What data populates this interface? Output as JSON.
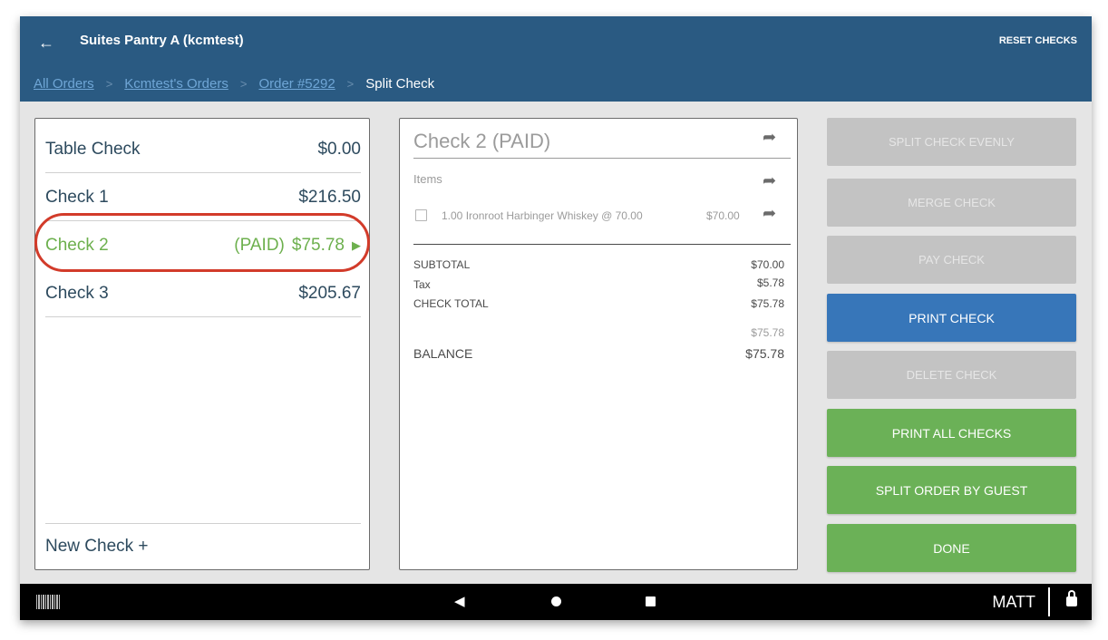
{
  "header": {
    "back_icon": "arrow-left-icon",
    "title": "Suites Pantry A (kcmtest)",
    "reset_label": "RESET CHECKS"
  },
  "breadcrumb": {
    "items": [
      "All Orders",
      "Kcmtest's Orders",
      "Order #5292"
    ],
    "separator": ">",
    "current": "Split Check"
  },
  "checks": {
    "list": [
      {
        "name": "Table Check",
        "status": "",
        "amount": "$0.00"
      },
      {
        "name": "Check 1",
        "status": "",
        "amount": "$216.50"
      },
      {
        "name": "Check 2",
        "status": "(PAID)",
        "amount": "$75.78",
        "selected": true
      },
      {
        "name": "Check 3",
        "status": "",
        "amount": "$205.67"
      }
    ],
    "selected_arrow": "▶",
    "new_check_label": "New Check +"
  },
  "detail": {
    "title": "Check 2 (PAID)",
    "items_label": "Items",
    "items": [
      {
        "description": "1.00 Ironroot Harbinger Whiskey @  70.00",
        "price": "$70.00"
      }
    ],
    "subtotal_label": "SUBTOTAL",
    "subtotal": "$70.00",
    "tax_label": "Tax",
    "tax": "$5.78",
    "total_label": "CHECK TOTAL",
    "total": "$75.78",
    "paid_amount": "$75.78",
    "balance_label": "BALANCE",
    "balance": "$75.78"
  },
  "actions": {
    "split_evenly": "SPLIT CHECK EVENLY",
    "merge": "MERGE CHECK",
    "pay": "PAY CHECK",
    "print": "PRINT CHECK",
    "delete": "DELETE CHECK",
    "print_all": "PRINT ALL CHECKS",
    "split_by_guest": "SPLIT ORDER BY GUEST",
    "done": "DONE"
  },
  "navbar": {
    "user": "MATT"
  },
  "colors": {
    "header": "#2a5a82",
    "paid_green": "#6db04e",
    "action_blue": "#3776b9",
    "action_green": "#6bb157",
    "disabled_grey": "#c3c3c3",
    "highlight_red": "#d23b2a"
  }
}
